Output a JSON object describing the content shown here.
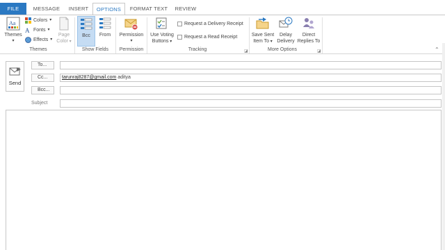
{
  "tabs": [
    {
      "label": "FILE"
    },
    {
      "label": "MESSAGE"
    },
    {
      "label": "INSERT"
    },
    {
      "label": "OPTIONS"
    },
    {
      "label": "FORMAT TEXT"
    },
    {
      "label": "REVIEW"
    }
  ],
  "ribbon": {
    "themes": {
      "themes_label": "Themes",
      "colors_label": "Colors",
      "fonts_label": "Fonts",
      "effects_label": "Effects",
      "page_color_label_1": "Page",
      "page_color_label_2": "Color",
      "group_label": "Themes"
    },
    "show_fields": {
      "bcc_label": "Bcc",
      "from_label": "From",
      "group_label": "Show Fields"
    },
    "permission": {
      "permission_label": "Permission",
      "group_label": "Permission"
    },
    "tracking": {
      "voting_label_1": "Use Voting",
      "voting_label_2": "Buttons",
      "delivery_receipt_label": "Request a Delivery Receipt",
      "read_receipt_label": "Request a Read Receipt",
      "group_label": "Tracking"
    },
    "more_options": {
      "save_sent_label_1": "Save Sent",
      "save_sent_label_2": "Item To",
      "delay_label_1": "Delay",
      "delay_label_2": "Delivery",
      "direct_label_1": "Direct",
      "direct_label_2": "Replies To",
      "group_label": "More Options"
    }
  },
  "compose": {
    "send_label": "Send",
    "to_label": "To...",
    "cc_label": "Cc...",
    "bcc_label": "Bcc...",
    "subject_label": "Subject",
    "cc_email": "tarunraj8287@gmail.com",
    "cc_text": "aditya",
    "to_value": "",
    "bcc_value": "",
    "subject_value": ""
  },
  "colors": {
    "accent": "#2b79c2",
    "bcc_active_bg": "#c5dcf3"
  }
}
